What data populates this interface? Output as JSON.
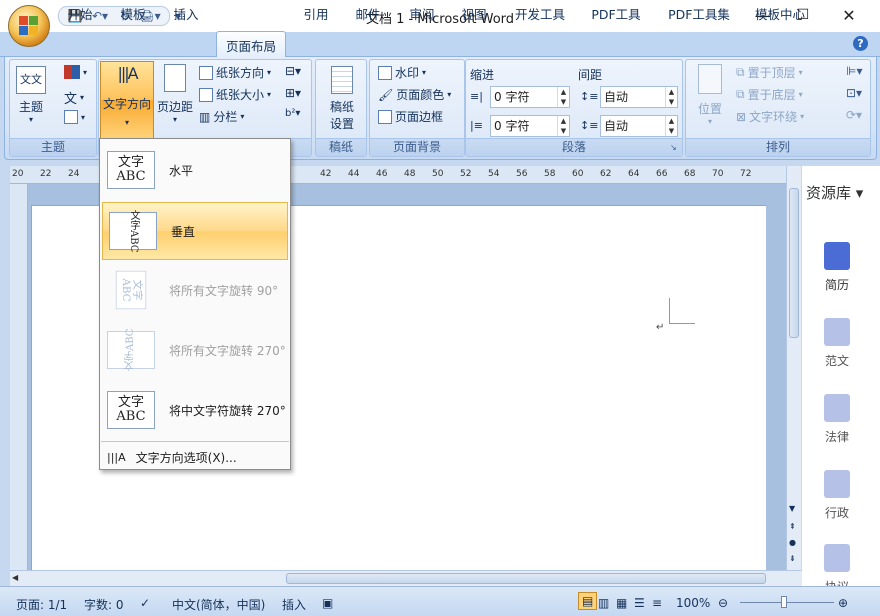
{
  "window": {
    "title": "文档 1 - Microsoft Word",
    "minimize": "—",
    "maximize": "☐",
    "close": "✕"
  },
  "qat": {
    "save": "💾",
    "undo": "↶▾",
    "redo": "↻",
    "print": "🖨▾",
    "customize": "▾"
  },
  "tabs": [
    "开始",
    "模板",
    "插入",
    "页面布局",
    "引用",
    "邮件",
    "审阅",
    "视图",
    "开发工具",
    "PDF工具",
    "PDF工具集",
    "模板中心"
  ],
  "active_tab": "页面布局",
  "help": "?",
  "ribbon": {
    "theme": {
      "button": "主题",
      "label": "主题"
    },
    "page_setup": {
      "text_direction": "文字方向",
      "margins": "页边距",
      "orientation": "纸张方向",
      "size": "纸张大小",
      "columns": "分栏",
      "label": ""
    },
    "draft_paper": {
      "button_line1": "稿纸",
      "button_line2": "设置",
      "label": "稿纸"
    },
    "page_background": {
      "watermark": "水印",
      "page_color": "页面颜色",
      "page_border": "页面边框",
      "label": "页面背景"
    },
    "paragraph": {
      "indent": "缩进",
      "spacing": "间距",
      "indent_left": "0 字符",
      "indent_right": "0 字符",
      "space_before": "自动",
      "space_after": "自动",
      "label": "段落"
    },
    "arrange": {
      "position": "位置",
      "bring_front": "置于顶层",
      "send_back": "置于底层",
      "wrap": "文字环绕",
      "label": "排列"
    }
  },
  "ruler_ticks": [
    "20",
    "22",
    "24",
    "",
    "",
    "",
    "",
    "",
    "",
    "",
    "",
    "42",
    "44",
    "46",
    "48",
    "50",
    "52",
    "54",
    "56",
    "58",
    "60",
    "62",
    "64",
    "66",
    "68",
    "70",
    "72"
  ],
  "dropdown": {
    "items": [
      {
        "icon": "文字\nABC",
        "label": "水平",
        "state": "normal"
      },
      {
        "icon": "文字ABC",
        "label": "垂直",
        "state": "selected"
      },
      {
        "icon": "文字\nABC",
        "label": "将所有文字旋转 90°",
        "state": "disabled"
      },
      {
        "icon": "文字ABC",
        "label": "将所有文字旋转 270°",
        "state": "disabled"
      },
      {
        "icon": "文字\nABC",
        "label": "将中文字符旋转 270°",
        "state": "normal"
      }
    ],
    "options": "文字方向选项(X)..."
  },
  "side_panel": {
    "title": "资源库",
    "items": [
      {
        "label": "简历",
        "color": "#4a6cd4"
      },
      {
        "label": "范文",
        "color": "#b6c1e8"
      },
      {
        "label": "法律",
        "color": "#b6c1e8"
      },
      {
        "label": "行政",
        "color": "#b6c1e8"
      },
      {
        "label": "协议",
        "color": "#b6c1e8"
      }
    ]
  },
  "status": {
    "page": "页面: 1/1",
    "words": "字数: 0",
    "language": "中文(简体，中国)",
    "mode": "插入",
    "zoom": "100%"
  }
}
